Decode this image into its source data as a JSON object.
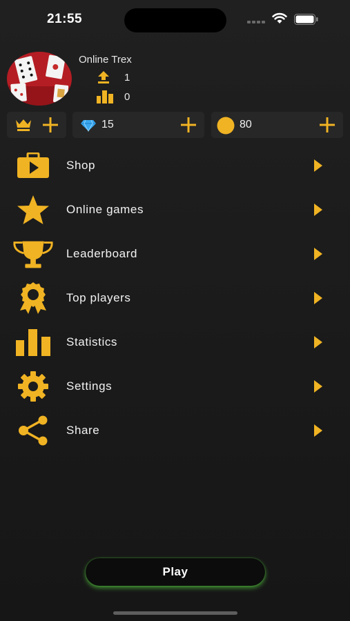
{
  "status_bar": {
    "time": "21:55",
    "icons": [
      "cellular-signal-icon",
      "wifi-icon",
      "battery-icon"
    ]
  },
  "profile": {
    "name": "Online Trex",
    "avatar": "playing-cards-avatar",
    "rank_value": "1",
    "rank_icon": "upload-arrow-icon",
    "stats_value": "0",
    "stats_icon": "bar-chart-icon"
  },
  "currency": {
    "vip_icon": "crown-icon",
    "gems": "15",
    "gems_icon": "diamond-icon",
    "coins": "80",
    "coins_icon": "coin-icon"
  },
  "menu": [
    {
      "label": "Shop",
      "icon": "briefcase-play-icon"
    },
    {
      "label": "Online games",
      "icon": "star-icon"
    },
    {
      "label": "Leaderboard",
      "icon": "trophy-icon"
    },
    {
      "label": "Top players",
      "icon": "award-rosette-icon"
    },
    {
      "label": "Statistics",
      "icon": "bar-chart-icon"
    },
    {
      "label": "Settings",
      "icon": "gear-icon"
    },
    {
      "label": "Share",
      "icon": "share-icon"
    }
  ],
  "play_label": "Play",
  "colors": {
    "accent": "#f0b323",
    "background": "#1c1c1c",
    "panel": "#272727",
    "play_glow": "#50be3c",
    "gem": "#3aa8f0"
  }
}
